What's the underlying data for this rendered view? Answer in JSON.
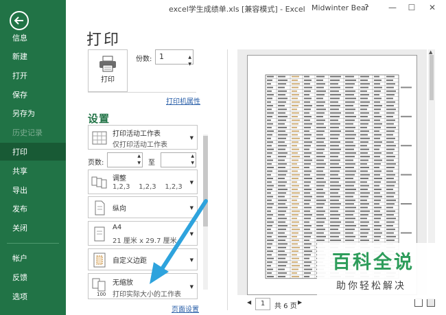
{
  "titlebar": {
    "title": "excel学生成绩单.xls [兼容模式] - Excel",
    "user": "Midwinter Bear",
    "help": "?",
    "minimize": "—",
    "restore": "☐",
    "close": "✕"
  },
  "sidebar": {
    "items": [
      {
        "label": "信息",
        "enabled": true
      },
      {
        "label": "新建",
        "enabled": true
      },
      {
        "label": "打开",
        "enabled": true
      },
      {
        "label": "保存",
        "enabled": true
      },
      {
        "label": "另存为",
        "enabled": true
      },
      {
        "label": "历史记录",
        "enabled": false
      },
      {
        "label": "打印",
        "enabled": true,
        "active": true
      },
      {
        "label": "共享",
        "enabled": true
      },
      {
        "label": "导出",
        "enabled": true
      },
      {
        "label": "发布",
        "enabled": true
      },
      {
        "label": "关闭",
        "enabled": true
      },
      {
        "label": "帐户",
        "enabled": true
      },
      {
        "label": "反馈",
        "enabled": true
      },
      {
        "label": "选项",
        "enabled": true
      }
    ]
  },
  "page_title": "打印",
  "print": {
    "button_label": "打印",
    "copies_label": "份数:",
    "copies_value": "1",
    "printer_properties": "打印机属性"
  },
  "settings": {
    "heading": "设置",
    "scope": {
      "line1": "打印活动工作表",
      "line2": "仅打印活动工作表"
    },
    "pages_label": "页数:",
    "to_label": "至",
    "collate": {
      "line1": "调整",
      "line2": "1,2,3    1,2,3    1,2,3"
    },
    "orientation": {
      "line1": "纵向"
    },
    "paper": {
      "line1": "A4",
      "line2": "21 厘米 x 29.7 厘米"
    },
    "margins": {
      "line1": "自定义边距"
    },
    "scaling": {
      "line1": "无缩放",
      "line2": "打印实际大小的工作表",
      "icon_text": "100"
    },
    "page_setup": "页面设置"
  },
  "preview": {
    "page_input": "1",
    "total_pages": "共 6 页"
  },
  "watermark": {
    "title": "百科全说",
    "subtitle": "助你轻松解决"
  },
  "colors": {
    "sidebar": "#217346",
    "sidebar_active": "#185a35",
    "accent_green": "#217346",
    "link_blue": "#2a5fa8",
    "arrow_blue": "#2ea3dd",
    "watermark_green": "#2d9c5a"
  }
}
